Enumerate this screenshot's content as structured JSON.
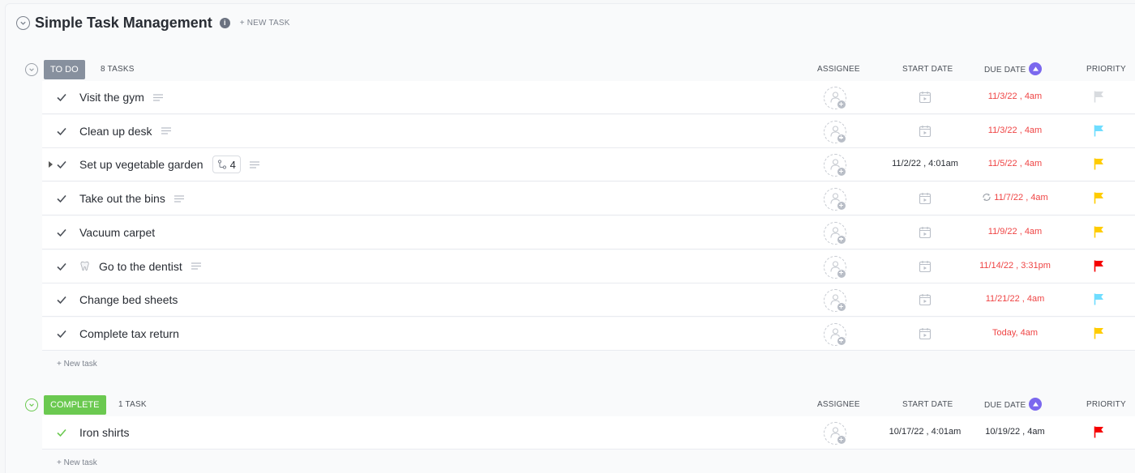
{
  "header": {
    "title": "Simple Task Management",
    "info_icon": "i",
    "new_task": "+ NEW TASK"
  },
  "groups": [
    {
      "status": "TO DO",
      "status_color": "#87909e",
      "count": "8 TASKS",
      "columns": {
        "assignee": "ASSIGNEE",
        "start_date": "START DATE",
        "due_date": "DUE DATE",
        "priority": "PRIORITY"
      },
      "new_task": "+ New task",
      "tasks": [
        {
          "name": "Visit the gym",
          "start": "",
          "due": "11/3/22 , 4am",
          "due_color": "#ef4444",
          "priority_color": "#d8dbdf",
          "has_desc": true
        },
        {
          "name": "Clean up desk",
          "start": "",
          "due": "11/3/22 , 4am",
          "due_color": "#ef4444",
          "priority_color": "#6fddff",
          "has_desc": true
        },
        {
          "name": "Set up vegetable garden",
          "start": "11/2/22 , 4:01am",
          "due": "11/5/22 , 4am",
          "due_color": "#ef4444",
          "priority_color": "#ffcc00",
          "has_desc": true,
          "subtasks": "4",
          "expandable": true
        },
        {
          "name": "Take out the bins",
          "start": "",
          "due": "11/7/22 , 4am",
          "due_color": "#ef4444",
          "priority_color": "#ffcc00",
          "has_desc": true,
          "recurring": true
        },
        {
          "name": "Vacuum carpet",
          "start": "",
          "due": "11/9/22 , 4am",
          "due_color": "#ef4444",
          "priority_color": "#ffcc00",
          "has_desc": false
        },
        {
          "name": "Go to the dentist",
          "start": "",
          "due": "11/14/22 , 3:31pm",
          "due_color": "#ef4444",
          "priority_color": "#f50000",
          "has_desc": true,
          "emoji_icon": "tooth-icon"
        },
        {
          "name": "Change bed sheets",
          "start": "",
          "due": "11/21/22 , 4am",
          "due_color": "#ef4444",
          "priority_color": "#6fddff",
          "has_desc": false
        },
        {
          "name": "Complete tax return",
          "start": "",
          "due": "Today, 4am",
          "due_color": "#ef4444",
          "priority_color": "#ffcc00",
          "has_desc": false
        }
      ]
    },
    {
      "status": "COMPLETE",
      "status_color": "#6bc950",
      "count": "1 TASK",
      "columns": {
        "assignee": "ASSIGNEE",
        "start_date": "START DATE",
        "due_date": "DUE DATE",
        "priority": "PRIORITY"
      },
      "new_task": "+ New task",
      "tasks": [
        {
          "name": "Iron shirts",
          "start": "10/17/22 , 4:01am",
          "due": "10/19/22 , 4am",
          "due_color": "#292d34",
          "priority_color": "#f50000",
          "has_desc": false,
          "check_color": "#6bc950"
        }
      ]
    }
  ]
}
